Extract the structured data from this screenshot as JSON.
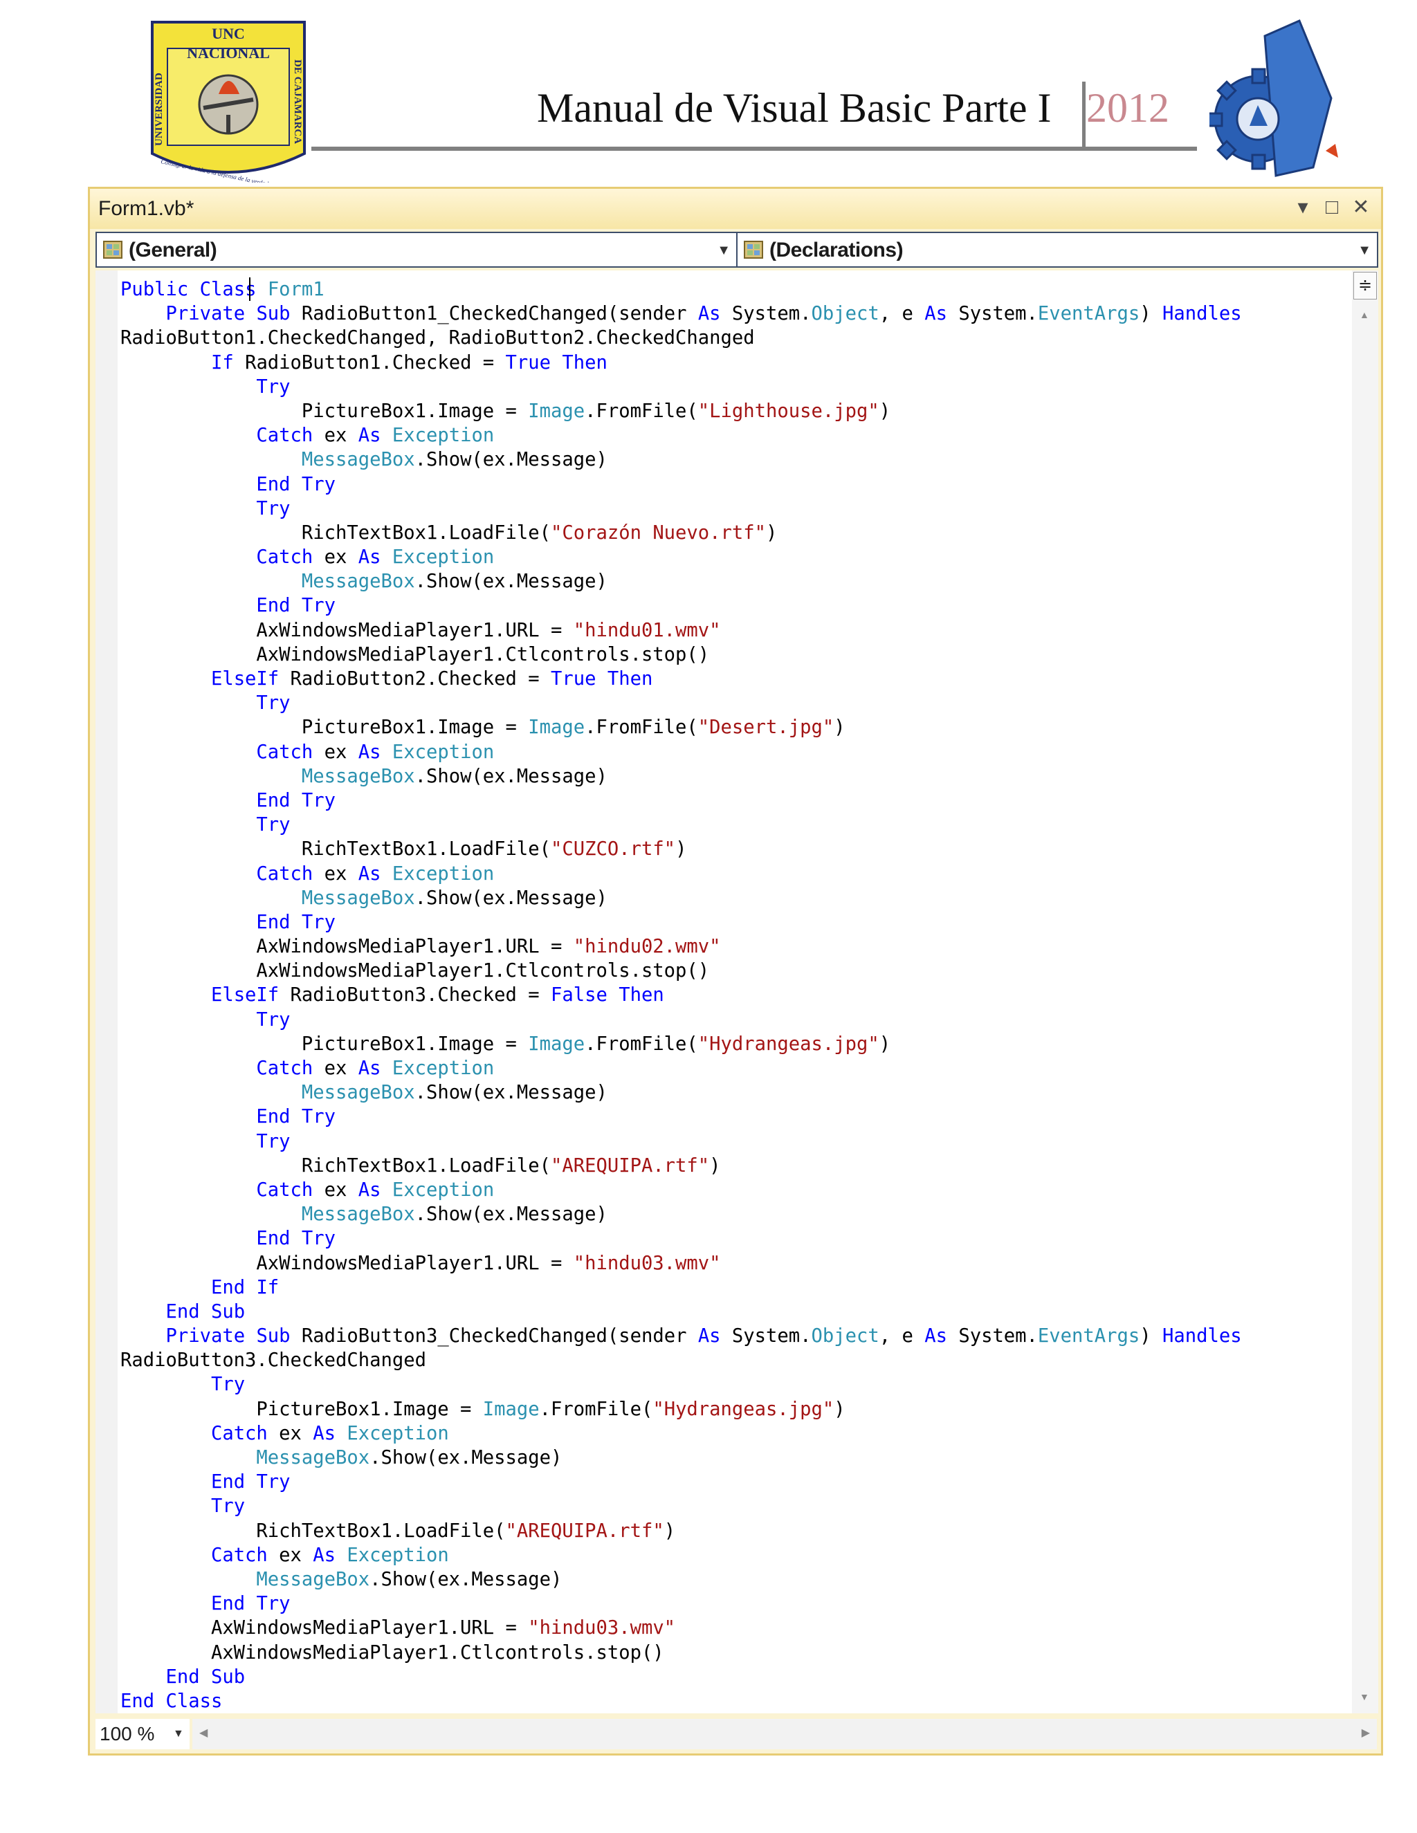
{
  "header": {
    "title": "Manual de Visual Basic Parte I",
    "year": "2012",
    "logo_left": {
      "line1": "UNC",
      "line2": "NACIONAL",
      "side_left": "UNIVERSIDAD",
      "side_right": "DE CAJAMARCA",
      "motto": "Consagrar la vida a la defensa de la verdad"
    },
    "logo_right": {
      "name": "gear-emblem-logo"
    }
  },
  "ide": {
    "tab_label": "Form1.vb*",
    "window_buttons": {
      "menu": "▾",
      "restore": "□",
      "close": "✕"
    },
    "left_dropdown": "(General)",
    "right_dropdown": "(Declarations)",
    "zoom": "100 %",
    "code_lines": [
      [
        {
          "t": "Public",
          "c": "kw"
        },
        {
          "t": " "
        },
        {
          "t": "Class",
          "c": "kw"
        },
        {
          "t": " "
        },
        {
          "t": "Form1",
          "c": "ty"
        }
      ],
      [
        {
          "t": "    "
        },
        {
          "t": "Private",
          "c": "kw"
        },
        {
          "t": " "
        },
        {
          "t": "Sub",
          "c": "kw"
        },
        {
          "t": " RadioButton1_CheckedChanged(sender "
        },
        {
          "t": "As",
          "c": "kw"
        },
        {
          "t": " System."
        },
        {
          "t": "Object",
          "c": "ty"
        },
        {
          "t": ", e "
        },
        {
          "t": "As",
          "c": "kw"
        },
        {
          "t": " System."
        },
        {
          "t": "EventArgs",
          "c": "ty"
        },
        {
          "t": ") "
        },
        {
          "t": "Handles",
          "c": "kw"
        }
      ],
      [
        {
          "t": "RadioButton1.CheckedChanged, RadioButton2.CheckedChanged"
        }
      ],
      [
        {
          "t": "        "
        },
        {
          "t": "If",
          "c": "kw"
        },
        {
          "t": " RadioButton1.Checked = "
        },
        {
          "t": "True",
          "c": "kw"
        },
        {
          "t": " "
        },
        {
          "t": "Then",
          "c": "kw"
        }
      ],
      [
        {
          "t": "            "
        },
        {
          "t": "Try",
          "c": "kw"
        }
      ],
      [
        {
          "t": "                PictureBox1.Image = "
        },
        {
          "t": "Image",
          "c": "ty"
        },
        {
          "t": ".FromFile("
        },
        {
          "t": "\"Lighthouse.jpg\"",
          "c": "st"
        },
        {
          "t": ")"
        }
      ],
      [
        {
          "t": "            "
        },
        {
          "t": "Catch",
          "c": "kw"
        },
        {
          "t": " ex "
        },
        {
          "t": "As",
          "c": "kw"
        },
        {
          "t": " "
        },
        {
          "t": "Exception",
          "c": "ty"
        }
      ],
      [
        {
          "t": "                "
        },
        {
          "t": "MessageBox",
          "c": "ty"
        },
        {
          "t": ".Show(ex.Message)"
        }
      ],
      [
        {
          "t": "            "
        },
        {
          "t": "End",
          "c": "kw"
        },
        {
          "t": " "
        },
        {
          "t": "Try",
          "c": "kw"
        }
      ],
      [
        {
          "t": "            "
        },
        {
          "t": "Try",
          "c": "kw"
        }
      ],
      [
        {
          "t": "                RichTextBox1.LoadFile("
        },
        {
          "t": "\"Corazón Nuevo.rtf\"",
          "c": "st"
        },
        {
          "t": ")"
        }
      ],
      [
        {
          "t": "            "
        },
        {
          "t": "Catch",
          "c": "kw"
        },
        {
          "t": " ex "
        },
        {
          "t": "As",
          "c": "kw"
        },
        {
          "t": " "
        },
        {
          "t": "Exception",
          "c": "ty"
        }
      ],
      [
        {
          "t": "                "
        },
        {
          "t": "MessageBox",
          "c": "ty"
        },
        {
          "t": ".Show(ex.Message)"
        }
      ],
      [
        {
          "t": "            "
        },
        {
          "t": "End",
          "c": "kw"
        },
        {
          "t": " "
        },
        {
          "t": "Try",
          "c": "kw"
        }
      ],
      [
        {
          "t": "            AxWindowsMediaPlayer1.URL = "
        },
        {
          "t": "\"hindu01.wmv\"",
          "c": "st"
        }
      ],
      [
        {
          "t": "            AxWindowsMediaPlayer1.Ctlcontrols.stop()"
        }
      ],
      [
        {
          "t": "        "
        },
        {
          "t": "ElseIf",
          "c": "kw"
        },
        {
          "t": " RadioButton2.Checked = "
        },
        {
          "t": "True",
          "c": "kw"
        },
        {
          "t": " "
        },
        {
          "t": "Then",
          "c": "kw"
        }
      ],
      [
        {
          "t": "            "
        },
        {
          "t": "Try",
          "c": "kw"
        }
      ],
      [
        {
          "t": "                PictureBox1.Image = "
        },
        {
          "t": "Image",
          "c": "ty"
        },
        {
          "t": ".FromFile("
        },
        {
          "t": "\"Desert.jpg\"",
          "c": "st"
        },
        {
          "t": ")"
        }
      ],
      [
        {
          "t": "            "
        },
        {
          "t": "Catch",
          "c": "kw"
        },
        {
          "t": " ex "
        },
        {
          "t": "As",
          "c": "kw"
        },
        {
          "t": " "
        },
        {
          "t": "Exception",
          "c": "ty"
        }
      ],
      [
        {
          "t": "                "
        },
        {
          "t": "MessageBox",
          "c": "ty"
        },
        {
          "t": ".Show(ex.Message)"
        }
      ],
      [
        {
          "t": "            "
        },
        {
          "t": "End",
          "c": "kw"
        },
        {
          "t": " "
        },
        {
          "t": "Try",
          "c": "kw"
        }
      ],
      [
        {
          "t": "            "
        },
        {
          "t": "Try",
          "c": "kw"
        }
      ],
      [
        {
          "t": "                RichTextBox1.LoadFile("
        },
        {
          "t": "\"CUZCO.rtf\"",
          "c": "st"
        },
        {
          "t": ")"
        }
      ],
      [
        {
          "t": "            "
        },
        {
          "t": "Catch",
          "c": "kw"
        },
        {
          "t": " ex "
        },
        {
          "t": "As",
          "c": "kw"
        },
        {
          "t": " "
        },
        {
          "t": "Exception",
          "c": "ty"
        }
      ],
      [
        {
          "t": "                "
        },
        {
          "t": "MessageBox",
          "c": "ty"
        },
        {
          "t": ".Show(ex.Message)"
        }
      ],
      [
        {
          "t": "            "
        },
        {
          "t": "End",
          "c": "kw"
        },
        {
          "t": " "
        },
        {
          "t": "Try",
          "c": "kw"
        }
      ],
      [
        {
          "t": "            AxWindowsMediaPlayer1.URL = "
        },
        {
          "t": "\"hindu02.wmv\"",
          "c": "st"
        }
      ],
      [
        {
          "t": "            AxWindowsMediaPlayer1.Ctlcontrols.stop()"
        }
      ],
      [
        {
          "t": "        "
        },
        {
          "t": "ElseIf",
          "c": "kw"
        },
        {
          "t": " RadioButton3.Checked = "
        },
        {
          "t": "False",
          "c": "kw"
        },
        {
          "t": " "
        },
        {
          "t": "Then",
          "c": "kw"
        }
      ],
      [
        {
          "t": "            "
        },
        {
          "t": "Try",
          "c": "kw"
        }
      ],
      [
        {
          "t": "                PictureBox1.Image = "
        },
        {
          "t": "Image",
          "c": "ty"
        },
        {
          "t": ".FromFile("
        },
        {
          "t": "\"Hydrangeas.jpg\"",
          "c": "st"
        },
        {
          "t": ")"
        }
      ],
      [
        {
          "t": "            "
        },
        {
          "t": "Catch",
          "c": "kw"
        },
        {
          "t": " ex "
        },
        {
          "t": "As",
          "c": "kw"
        },
        {
          "t": " "
        },
        {
          "t": "Exception",
          "c": "ty"
        }
      ],
      [
        {
          "t": "                "
        },
        {
          "t": "MessageBox",
          "c": "ty"
        },
        {
          "t": ".Show(ex.Message)"
        }
      ],
      [
        {
          "t": "            "
        },
        {
          "t": "End",
          "c": "kw"
        },
        {
          "t": " "
        },
        {
          "t": "Try",
          "c": "kw"
        }
      ],
      [
        {
          "t": "            "
        },
        {
          "t": "Try",
          "c": "kw"
        }
      ],
      [
        {
          "t": "                RichTextBox1.LoadFile("
        },
        {
          "t": "\"AREQUIPA.rtf\"",
          "c": "st"
        },
        {
          "t": ")"
        }
      ],
      [
        {
          "t": "            "
        },
        {
          "t": "Catch",
          "c": "kw"
        },
        {
          "t": " ex "
        },
        {
          "t": "As",
          "c": "kw"
        },
        {
          "t": " "
        },
        {
          "t": "Exception",
          "c": "ty"
        }
      ],
      [
        {
          "t": "                "
        },
        {
          "t": "MessageBox",
          "c": "ty"
        },
        {
          "t": ".Show(ex.Message)"
        }
      ],
      [
        {
          "t": "            "
        },
        {
          "t": "End",
          "c": "kw"
        },
        {
          "t": " "
        },
        {
          "t": "Try",
          "c": "kw"
        }
      ],
      [
        {
          "t": "            AxWindowsMediaPlayer1.URL = "
        },
        {
          "t": "\"hindu03.wmv\"",
          "c": "st"
        }
      ],
      [
        {
          "t": "        "
        },
        {
          "t": "End",
          "c": "kw"
        },
        {
          "t": " "
        },
        {
          "t": "If",
          "c": "kw"
        }
      ],
      [
        {
          "t": "    "
        },
        {
          "t": "End",
          "c": "kw"
        },
        {
          "t": " "
        },
        {
          "t": "Sub",
          "c": "kw"
        }
      ],
      [
        {
          "t": "    "
        },
        {
          "t": "Private",
          "c": "kw"
        },
        {
          "t": " "
        },
        {
          "t": "Sub",
          "c": "kw"
        },
        {
          "t": " RadioButton3_CheckedChanged(sender "
        },
        {
          "t": "As",
          "c": "kw"
        },
        {
          "t": " System."
        },
        {
          "t": "Object",
          "c": "ty"
        },
        {
          "t": ", e "
        },
        {
          "t": "As",
          "c": "kw"
        },
        {
          "t": " System."
        },
        {
          "t": "EventArgs",
          "c": "ty"
        },
        {
          "t": ") "
        },
        {
          "t": "Handles",
          "c": "kw"
        }
      ],
      [
        {
          "t": "RadioButton3.CheckedChanged"
        }
      ],
      [
        {
          "t": "        "
        },
        {
          "t": "Try",
          "c": "kw"
        }
      ],
      [
        {
          "t": "            PictureBox1.Image = "
        },
        {
          "t": "Image",
          "c": "ty"
        },
        {
          "t": ".FromFile("
        },
        {
          "t": "\"Hydrangeas.jpg\"",
          "c": "st"
        },
        {
          "t": ")"
        }
      ],
      [
        {
          "t": "        "
        },
        {
          "t": "Catch",
          "c": "kw"
        },
        {
          "t": " ex "
        },
        {
          "t": "As",
          "c": "kw"
        },
        {
          "t": " "
        },
        {
          "t": "Exception",
          "c": "ty"
        }
      ],
      [
        {
          "t": "            "
        },
        {
          "t": "MessageBox",
          "c": "ty"
        },
        {
          "t": ".Show(ex.Message)"
        }
      ],
      [
        {
          "t": "        "
        },
        {
          "t": "End",
          "c": "kw"
        },
        {
          "t": " "
        },
        {
          "t": "Try",
          "c": "kw"
        }
      ],
      [
        {
          "t": "        "
        },
        {
          "t": "Try",
          "c": "kw"
        }
      ],
      [
        {
          "t": "            RichTextBox1.LoadFile("
        },
        {
          "t": "\"AREQUIPA.rtf\"",
          "c": "st"
        },
        {
          "t": ")"
        }
      ],
      [
        {
          "t": "        "
        },
        {
          "t": "Catch",
          "c": "kw"
        },
        {
          "t": " ex "
        },
        {
          "t": "As",
          "c": "kw"
        },
        {
          "t": " "
        },
        {
          "t": "Exception",
          "c": "ty"
        }
      ],
      [
        {
          "t": "            "
        },
        {
          "t": "MessageBox",
          "c": "ty"
        },
        {
          "t": ".Show(ex.Message)"
        }
      ],
      [
        {
          "t": "        "
        },
        {
          "t": "End",
          "c": "kw"
        },
        {
          "t": " "
        },
        {
          "t": "Try",
          "c": "kw"
        }
      ],
      [
        {
          "t": "        AxWindowsMediaPlayer1.URL = "
        },
        {
          "t": "\"hindu03.wmv\"",
          "c": "st"
        }
      ],
      [
        {
          "t": "        AxWindowsMediaPlayer1.Ctlcontrols.stop()"
        }
      ],
      [
        {
          "t": "    "
        },
        {
          "t": "End",
          "c": "kw"
        },
        {
          "t": " "
        },
        {
          "t": "Sub",
          "c": "kw"
        }
      ],
      [
        {
          "t": "End",
          "c": "kw"
        },
        {
          "t": " "
        },
        {
          "t": "Class",
          "c": "kw"
        }
      ]
    ]
  },
  "colors": {
    "keyword": "#0000ff",
    "type": "#2b91af",
    "string": "#a31515",
    "ide_border": "#e7cc74",
    "year_accent": "#c9888f"
  }
}
